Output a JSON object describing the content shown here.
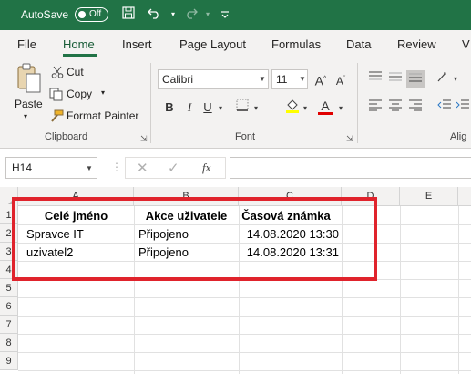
{
  "titlebar": {
    "autosave_label": "AutoSave",
    "toggle_label": "Off"
  },
  "tabs": [
    {
      "label": "File"
    },
    {
      "label": "Home"
    },
    {
      "label": "Insert"
    },
    {
      "label": "Page Layout"
    },
    {
      "label": "Formulas"
    },
    {
      "label": "Data"
    },
    {
      "label": "Review"
    },
    {
      "label": "V"
    }
  ],
  "ribbon": {
    "clipboard": {
      "paste_label": "Paste",
      "cut_label": "Cut",
      "copy_label": "Copy",
      "format_painter_label": "Format Painter",
      "group_label": "Clipboard"
    },
    "font": {
      "font_name": "Calibri",
      "font_size": "11",
      "group_label": "Font"
    },
    "alignment": {
      "group_label": "Alig"
    }
  },
  "formula_bar": {
    "name_box": "H14",
    "fx_label": "fx",
    "formula": ""
  },
  "grid": {
    "columns": [
      "A",
      "B",
      "C",
      "D",
      "E"
    ],
    "rows": [
      "1",
      "2",
      "3",
      "4",
      "5",
      "6",
      "7",
      "8",
      "9"
    ],
    "headers": [
      "Celé jméno",
      "Akce uživatele",
      "Časová známka"
    ],
    "data": [
      [
        "Spravce IT",
        "Připojeno",
        "14.08.2020 13:30"
      ],
      [
        "uzivatel2",
        "Připojeno",
        "14.08.2020 13:31"
      ]
    ]
  },
  "colors": {
    "excel_green": "#217346",
    "highlight_red": "#e0232c"
  }
}
